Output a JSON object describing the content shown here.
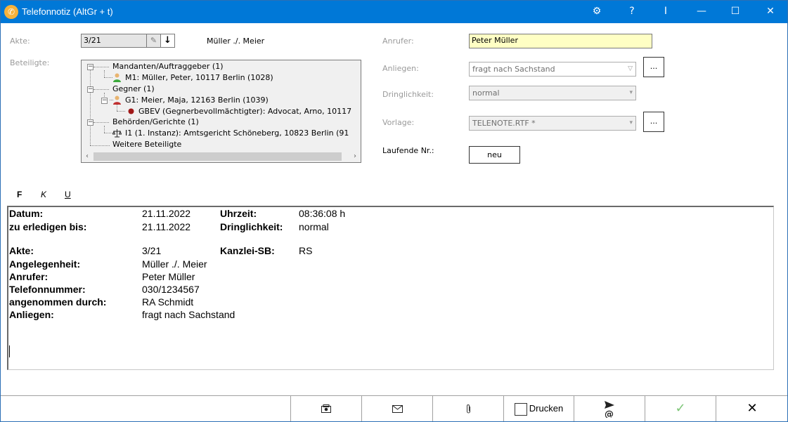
{
  "window": {
    "title": "Telefonnotiz (AltGr + t)",
    "title_icon": "phone-icon",
    "controls": {
      "settings": "⚙",
      "help": "?",
      "info": "I",
      "minimize": "—",
      "maximize": "☐",
      "close": "✕"
    }
  },
  "form": {
    "akte_label": "Akte:",
    "akte_value": "3/21",
    "akte_name": "Müller ./. Meier",
    "beteiligte_label": "Beteiligte:",
    "anrufer_label": "Anrufer:",
    "anrufer_value": "Peter Müller",
    "anliegen_label": "Anliegen:",
    "anliegen_value": "fragt nach Sachstand",
    "dringlichkeit_label": "Dringlichkeit:",
    "dringlichkeit_value": "normal",
    "vorlage_label": "Vorlage:",
    "vorlage_value": "TELENOTE.RTF *",
    "laufende_label": "Laufende Nr.:",
    "neu_label": "neu",
    "dots": "..."
  },
  "tree": {
    "items": [
      {
        "label": "Mandanten/Auftraggeber (1)"
      },
      {
        "label": "M1: Müller, Peter, 10117 Berlin (1028)"
      },
      {
        "label": "Gegner (1)"
      },
      {
        "label": "G1: Meier, Maja, 12163 Berlin (1039)"
      },
      {
        "label": "GBEV (Gegnerbevollmächtigter): Advocat, Arno, 10117"
      },
      {
        "label": "Behörden/Gerichte (1)"
      },
      {
        "label": "I1 (1. Instanz): Amtsgericht Schöneberg, 10823 Berlin (91"
      },
      {
        "label": "Weitere Beteiligte"
      }
    ]
  },
  "format_toolbar": {
    "bold": "F",
    "italic": "K",
    "underline": "U"
  },
  "editor": {
    "datum_label": "Datum:",
    "datum_value": "21.11.2022",
    "uhrzeit_label": "Uhrzeit:",
    "uhrzeit_value": "08:36:08 h",
    "erledigen_label": "zu erledigen bis:",
    "erledigen_value": "21.11.2022",
    "dringlichkeit_label": "Dringlichkeit:",
    "dringlichkeit_value": "normal",
    "akte_label": "Akte:",
    "akte_value": "3/21",
    "kanzlei_label": "Kanzlei-SB:",
    "kanzlei_value": "RS",
    "angelegenheit_label": "Angelegenheit:",
    "angelegenheit_value": "Müller ./. Meier",
    "anrufer_label": "Anrufer:",
    "anrufer_value": "Peter Müller",
    "telefon_label": "Telefonnummer:",
    "telefon_value": "030/1234567",
    "angenommen_label": "angenommen durch:",
    "angenommen_value": "RA Schmidt",
    "anliegen_label": "Anliegen:",
    "anliegen_value": "fragt nach Sachstand"
  },
  "bottom_bar": {
    "drucken_label": "Drucken",
    "ok": "✓",
    "cancel": "✕"
  },
  "colors": {
    "titlebar": "#0078d7",
    "anrufer_bg": "#ffffc4",
    "ok_green": "#7cc576"
  }
}
